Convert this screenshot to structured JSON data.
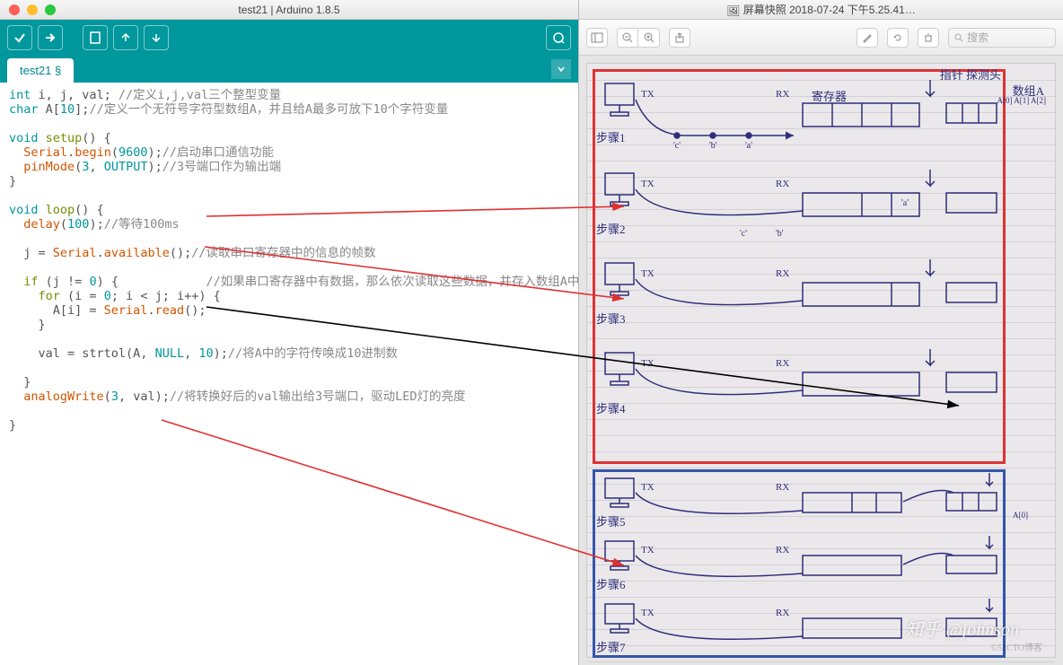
{
  "arduino": {
    "title": "test21 | Arduino 1.8.5",
    "tab": "test21 §",
    "code": {
      "l1_decl": "int i, j, val;",
      "l1_comment": " //定义i,j,val三个整型变量",
      "l2_decl": "char A[10];",
      "l2_comment": "//定义一个无符号字符型数组A，并且给A最多可放下10个字符变量",
      "l3": "void setup() {",
      "l4_a": "  Serial.begin",
      "l4_b": "(9600);",
      "l4_comment": "//启动串口通信功能",
      "l5_a": "  pinMode",
      "l5_b": "(3, ",
      "l5_c": "OUTPUT",
      "l5_d": ");",
      "l5_comment": "//3号端口作为输出端",
      "l6": "}",
      "l7": "void loop() {",
      "l8_a": "  delay",
      "l8_b": "(100);",
      "l8_comment": "//等待100ms",
      "l9_a": "  j = ",
      "l9_b": "Serial.available",
      "l9_c": "();",
      "l9_comment": "//读取串口寄存器中的信息的帧数",
      "l10": "  if (j != 0) {",
      "l10_comment": "            //如果串口寄存器中有数据，那么依次读取这些数据，并存入数组A中",
      "l11": "    for (i = 0; i < j; i++) {",
      "l12_a": "      A[i] = ",
      "l12_b": "Serial.read",
      "l12_c": "();",
      "l13": "    }",
      "l14_a": "    val = strtol(A, ",
      "l14_b": "NULL",
      "l14_c": ", 10);",
      "l14_comment": "//将A中的字符传唤成10进制数",
      "l15": "  }",
      "l16_a": "  analogWrite",
      "l16_b": "(3, val);",
      "l16_comment": "//将转换好后的val输出给3号端口，驱动LED灯的亮度",
      "l17": "}"
    }
  },
  "finder": {
    "title": "屏幕快照 2018-07-24 下午5.25.41…",
    "search_placeholder": "搜索"
  },
  "notebook": {
    "header1": "指针 探测头",
    "header2": "数组A",
    "header3": "寄存器",
    "cells": "A[0] A[1] A[2]",
    "step1": "步骤1",
    "step2": "步骤2",
    "step3": "步骤3",
    "step4": "步骤4",
    "step5": "步骤5",
    "step6": "步骤6",
    "step7": "步骤7",
    "tx": "TX",
    "rx": "RX",
    "chars_a": "'a'",
    "chars_b": "'b'",
    "chars_c": "'c'",
    "arr_a0": "A[0]"
  },
  "watermark": "知乎 @johnson",
  "footer": "©51CTO博客"
}
